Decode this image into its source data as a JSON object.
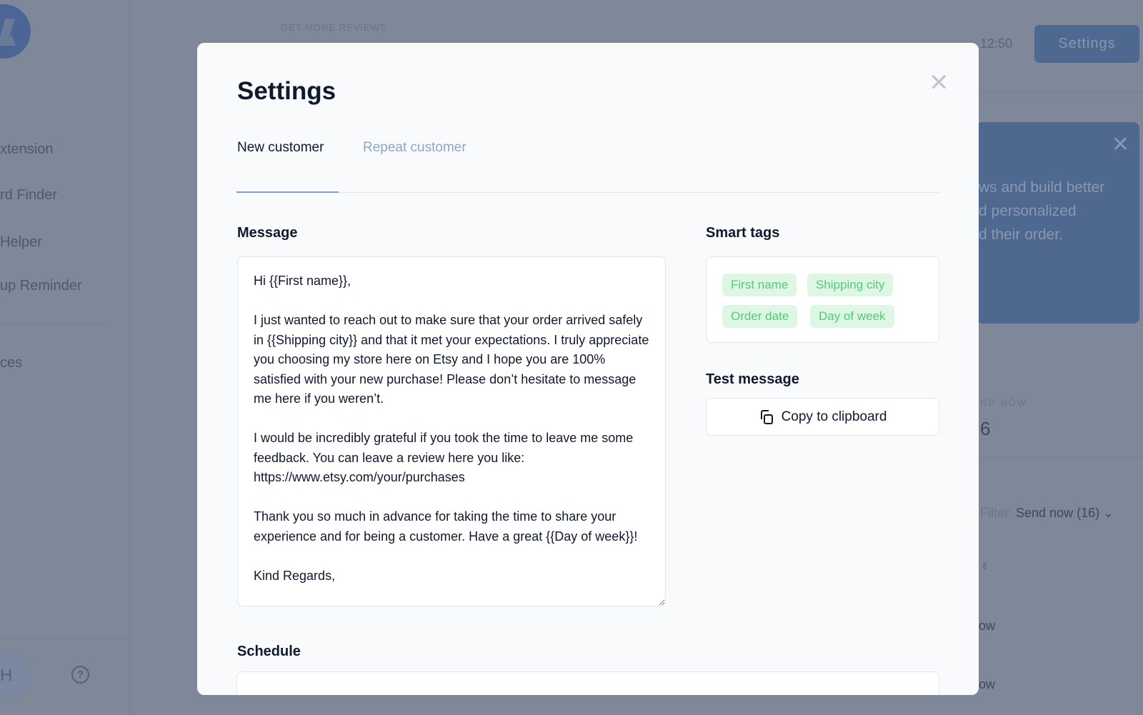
{
  "background": {
    "sidebar": {
      "items": [
        "xtension",
        "rd Finder",
        "Helper",
        "up Reminder",
        "ces"
      ],
      "avatar_initial": "H",
      "help_icon": "question-circle-icon"
    },
    "header": {
      "eyebrow": "GET MORE REVIEWS",
      "updated": "12:50",
      "settings_button": "Settings"
    },
    "banner": {
      "lines": [
        "ws and build better",
        "d personalized",
        "d their order."
      ]
    },
    "stat": {
      "label": "ND NOW",
      "value": "6"
    },
    "filter": {
      "label": "Filter:",
      "value": "Send now (16)"
    },
    "rows": [
      "ow",
      "ow"
    ]
  },
  "modal": {
    "title": "Settings",
    "tabs": [
      {
        "label": "New customer",
        "active": true
      },
      {
        "label": "Repeat customer",
        "active": false
      }
    ],
    "message": {
      "label": "Message",
      "value": "Hi {{First name}},\n\nI just wanted to reach out to make sure that your order arrived safely in {{Shipping city}} and that it met your expectations. I truly appreciate you choosing my store here on Etsy and I hope you are 100% satisfied with your new purchase! Please don’t hesitate to message me here if you weren’t.\n\nI would be incredibly grateful if you took the time to leave me some feedback. You can leave a review here you like: https://www.etsy.com/your/purchases\n\nThank you so much in advance for taking the time to share your experience and for being a customer. Have a great {{Day of week}}!\n\nKind Regards,"
    },
    "smart_tags": {
      "label": "Smart tags",
      "tags": [
        "First name",
        "Shipping city",
        "Order date",
        "Day of week"
      ],
      "color": "#4fcc76"
    },
    "test_message": {
      "label": "Test message",
      "button": "Copy to clipboard"
    },
    "schedule": {
      "label": "Schedule"
    }
  }
}
